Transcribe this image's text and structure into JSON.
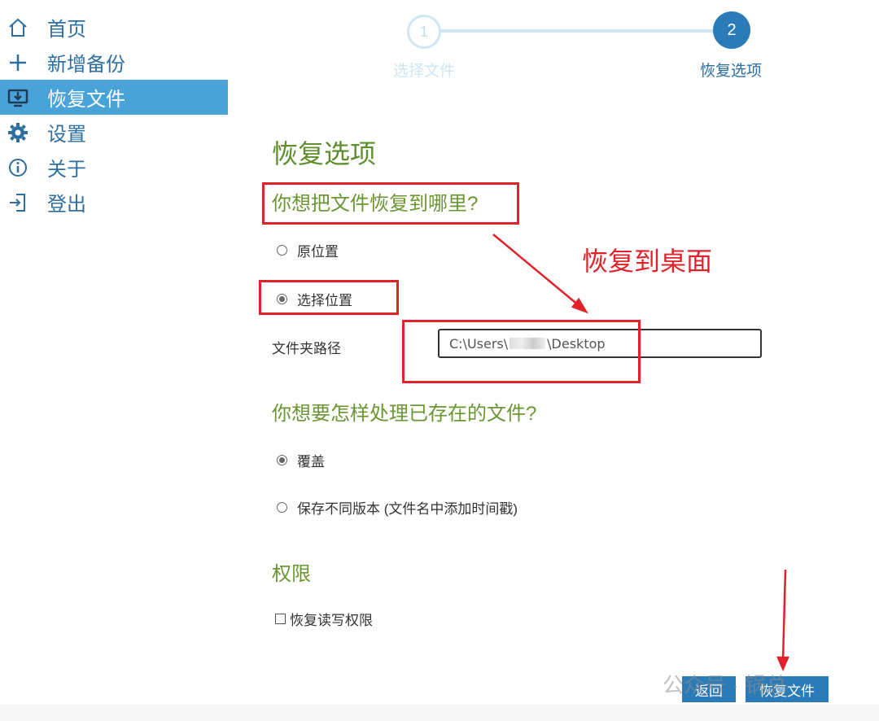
{
  "sidebar": {
    "items": [
      {
        "label": "首页",
        "icon": "home-icon"
      },
      {
        "label": "新增备份",
        "icon": "plus-icon"
      },
      {
        "label": "恢复文件",
        "icon": "restore-monitor-icon",
        "active": true
      },
      {
        "label": "设置",
        "icon": "gear-icon"
      },
      {
        "label": "关于",
        "icon": "info-icon"
      },
      {
        "label": "登出",
        "icon": "logout-icon"
      }
    ]
  },
  "stepper": {
    "steps": [
      {
        "number": "1",
        "label": "选择文件"
      },
      {
        "number": "2",
        "label": "恢复选项"
      }
    ]
  },
  "main": {
    "title": "恢复选项",
    "restore_question": "你想把文件恢复到哪里?",
    "location_options": [
      {
        "label": "原位置",
        "checked": false
      },
      {
        "label": "选择位置",
        "checked": true
      }
    ],
    "folder_path_label": "文件夹路径",
    "folder_path_prefix": "C:\\Users\\",
    "folder_path_suffix": "\\Desktop",
    "existing_question": "你想要怎样处理已存在的文件?",
    "existing_options": [
      {
        "label": "覆盖",
        "checked": true
      },
      {
        "label": "保存不同版本 (文件名中添加时间戳)",
        "checked": false
      }
    ],
    "permissions_heading": "权限",
    "permissions_checkbox": "恢复读写权限"
  },
  "annotation": {
    "text": "恢复到桌面"
  },
  "buttons": {
    "back": "返回",
    "restore": "恢复文件"
  },
  "watermark": "公众号 · 锅总",
  "colors": {
    "accent": "#2a7bb8",
    "active_nav": "#4aa3d8",
    "heading_green": "#6b9634",
    "annotation_red": "#e0222a"
  }
}
